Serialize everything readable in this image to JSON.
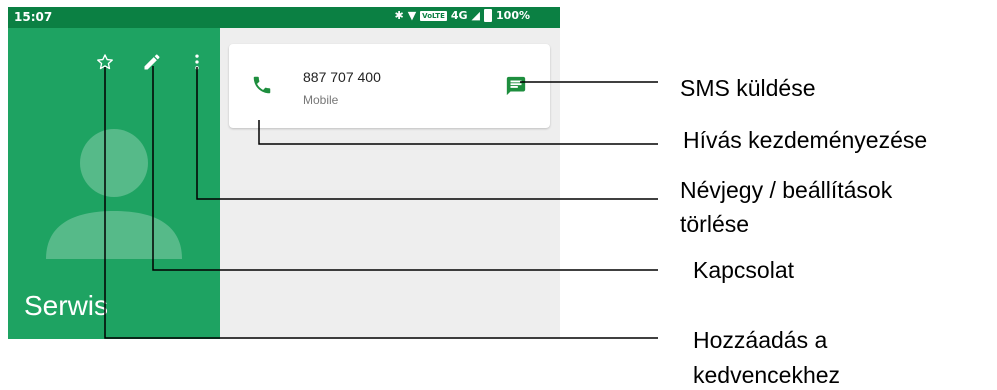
{
  "status_bar": {
    "time": "15:07",
    "network": "4G",
    "lte_badge": "VoLTE",
    "battery": "100%"
  },
  "header": {
    "contact_name": "Serwis",
    "accent_color": "#1ea362",
    "status_color": "#0b8043"
  },
  "card": {
    "number": "887 707 400",
    "type": "Mobile"
  },
  "callouts": {
    "sms": "SMS küldése",
    "call": "Hívás kezdeményezése",
    "delete_line1": "Névjegy / beállítások",
    "delete_line2": "törlése",
    "edit": "Kapcsolat",
    "favorite_line1": "Hozzáadás a",
    "favorite_line2": "kedvencekhez"
  },
  "icons": [
    "star-icon",
    "pencil-icon",
    "more-vert-icon",
    "phone-icon",
    "message-icon",
    "avatar-icon"
  ]
}
